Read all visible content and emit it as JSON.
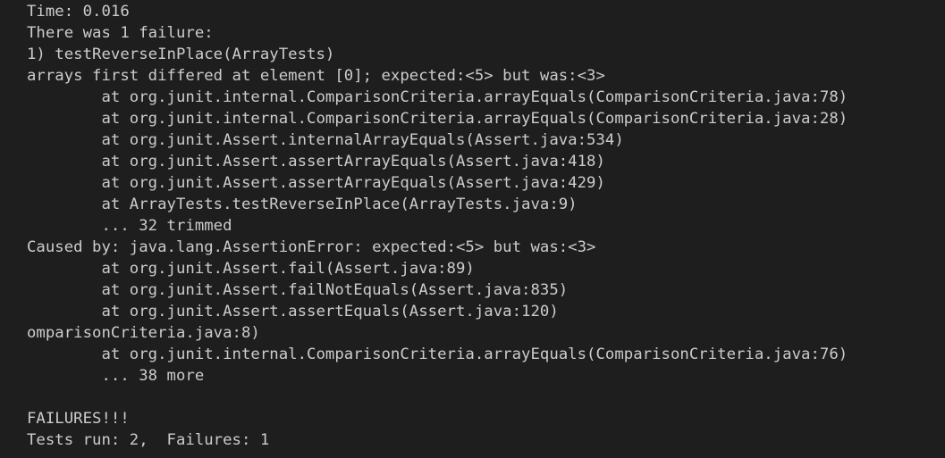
{
  "terminal": {
    "lines": [
      "Time: 0.016",
      "There was 1 failure:",
      "1) testReverseInPlace(ArrayTests)",
      "arrays first differed at element [0]; expected:<5> but was:<3>",
      "        at org.junit.internal.ComparisonCriteria.arrayEquals(ComparisonCriteria.java:78)",
      "        at org.junit.internal.ComparisonCriteria.arrayEquals(ComparisonCriteria.java:28)",
      "        at org.junit.Assert.internalArrayEquals(Assert.java:534)",
      "        at org.junit.Assert.assertArrayEquals(Assert.java:418)",
      "        at org.junit.Assert.assertArrayEquals(Assert.java:429)",
      "        at ArrayTests.testReverseInPlace(ArrayTests.java:9)",
      "        ... 32 trimmed",
      "Caused by: java.lang.AssertionError: expected:<5> but was:<3>",
      "        at org.junit.Assert.fail(Assert.java:89)",
      "        at org.junit.Assert.failNotEquals(Assert.java:835)",
      "        at org.junit.Assert.assertEquals(Assert.java:120)",
      "omparisonCriteria.java:8)",
      "        at org.junit.internal.ComparisonCriteria.arrayEquals(ComparisonCriteria.java:76)",
      "        ... 38 more",
      "",
      "FAILURES!!!",
      "Tests run: 2,  Failures: 1"
    ]
  }
}
